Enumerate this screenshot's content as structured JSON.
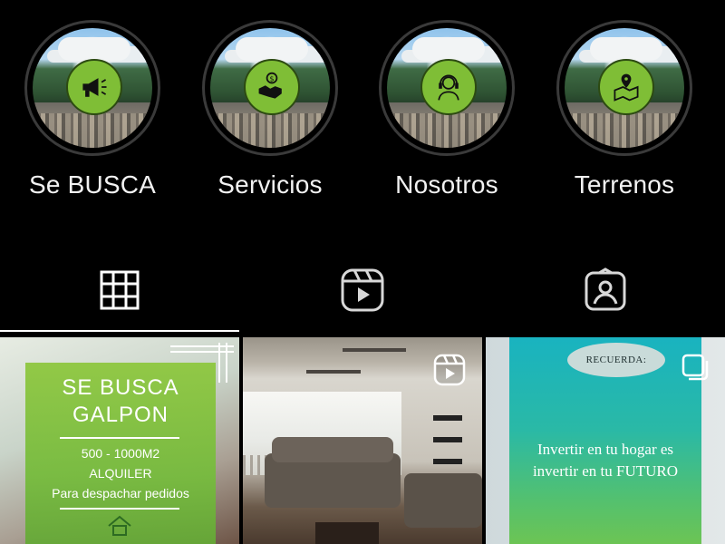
{
  "highlights": [
    {
      "label": "Se BUSCA",
      "icon": "megaphone-icon"
    },
    {
      "label": "Servicios",
      "icon": "handshake-money-icon"
    },
    {
      "label": "Nosotros",
      "icon": "support-agent-icon"
    },
    {
      "label": "Terrenos",
      "icon": "map-pin-icon"
    }
  ],
  "tabs": [
    {
      "name": "posts-grid",
      "icon": "grid-icon",
      "active": true
    },
    {
      "name": "reels",
      "icon": "reels-icon",
      "active": false
    },
    {
      "name": "tagged",
      "icon": "tagged-user-icon",
      "active": false
    }
  ],
  "posts": {
    "post1": {
      "title_line1": "SE BUSCA",
      "title_line2": "GALPON",
      "line1": "500 - 1000M2",
      "line2": "ALQUILER",
      "line3": "Para despachar pedidos"
    },
    "post2": {
      "badge_icon": "reels-icon"
    },
    "post3": {
      "pill": "RECUERDA:",
      "text_line1": "Invertir en tu hogar es",
      "text_line2": "invertir en tu FUTURO",
      "badge_icon": "multiple-images-icon"
    }
  },
  "colors": {
    "background": "#000000",
    "highlight_badge_green": "#7fbe36",
    "post1_green": "#76bb3d",
    "post3_teal": "#19b3c0"
  }
}
